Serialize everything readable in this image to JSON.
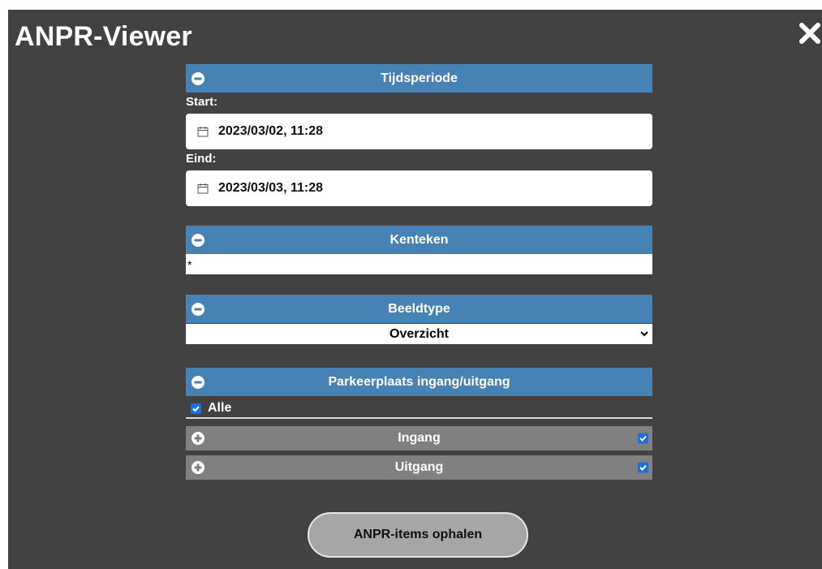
{
  "app": {
    "title": "ANPR-Viewer"
  },
  "sections": {
    "tijdsperiode": {
      "header": "Tijdsperiode",
      "start_label": "Start:",
      "start_value": "2023/03/02, 11:28",
      "end_label": "Eind:",
      "end_value": "2023/03/03, 11:28"
    },
    "kenteken": {
      "header": "Kenteken",
      "value": "*"
    },
    "beeldtype": {
      "header": "Beeldtype",
      "selected": "Overzicht"
    },
    "parkeerplaats": {
      "header": "Parkeerplaats ingang/uitgang",
      "all_label": "Alle",
      "all_checked": true,
      "groups": [
        {
          "label": "Ingang",
          "checked": true
        },
        {
          "label": "Uitgang",
          "checked": true
        }
      ]
    }
  },
  "actions": {
    "fetch_label": "ANPR-items ophalen"
  },
  "colors": {
    "background": "#424242",
    "header_blue": "#4682b4",
    "header_grey": "#808080",
    "checkbox": "#1e6fd9",
    "button": "#a6a6a6"
  },
  "icons": {
    "close": "close-icon",
    "collapse": "minus-circle-icon",
    "expand": "plus-circle-icon",
    "calendar": "calendar-icon",
    "dropdown": "chevron-down-icon"
  }
}
